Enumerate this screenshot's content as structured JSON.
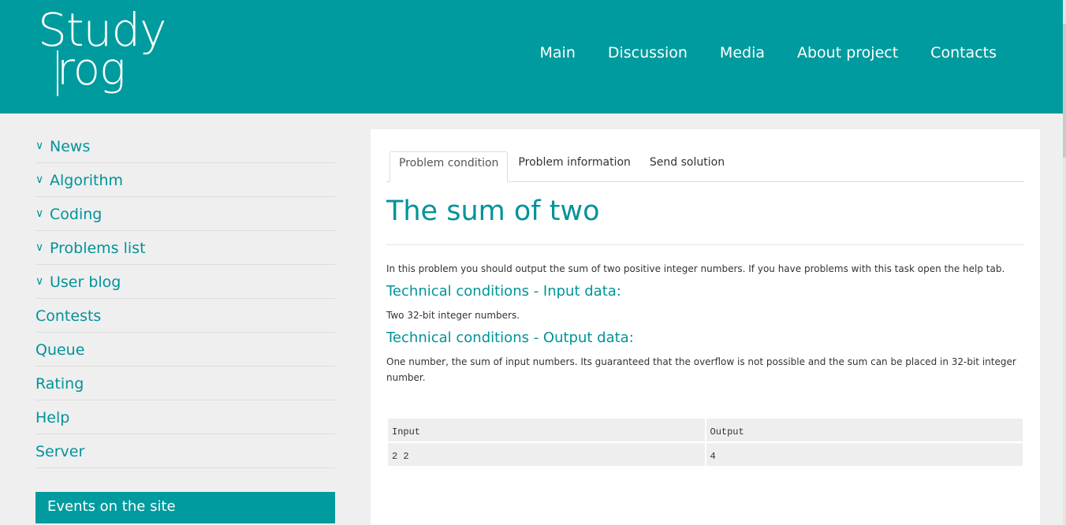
{
  "header": {
    "logo_line1": "Study",
    "logo_line2": "rog",
    "nav": [
      "Main",
      "Discussion",
      "Media",
      "About project",
      "Contacts"
    ]
  },
  "sidebar": {
    "items": [
      {
        "label": "News",
        "expandable": true
      },
      {
        "label": "Algorithm",
        "expandable": true
      },
      {
        "label": "Coding",
        "expandable": true
      },
      {
        "label": "Problems list",
        "expandable": true
      },
      {
        "label": "User blog",
        "expandable": true
      },
      {
        "label": "Contests",
        "expandable": false
      },
      {
        "label": "Queue",
        "expandable": false
      },
      {
        "label": "Rating",
        "expandable": false
      },
      {
        "label": "Help",
        "expandable": false
      },
      {
        "label": "Server",
        "expandable": false
      }
    ],
    "events_title": "Events on the site"
  },
  "main": {
    "tabs": [
      {
        "label": "Problem condition",
        "active": true
      },
      {
        "label": "Problem information",
        "active": false
      },
      {
        "label": "Send solution",
        "active": false
      }
    ],
    "title": "The sum of two",
    "intro": "In this problem you should output the sum of two positive integer numbers. If you have problems with this task open the help tab.",
    "input_heading": "Technical conditions - Input data:",
    "input_text": "Two 32-bit integer numbers.",
    "output_heading": "Technical conditions - Output data:",
    "output_text": "One number, the sum of input numbers. Its guaranteed that the overflow is not possible and the sum can be placed in 32-bit integer number.",
    "example": {
      "headers": [
        "Input",
        "Output"
      ],
      "rows": [
        [
          "2 2",
          "4"
        ]
      ]
    }
  },
  "colors": {
    "brand": "#009b9e",
    "accent_text": "#00939a",
    "background": "#efefef"
  }
}
